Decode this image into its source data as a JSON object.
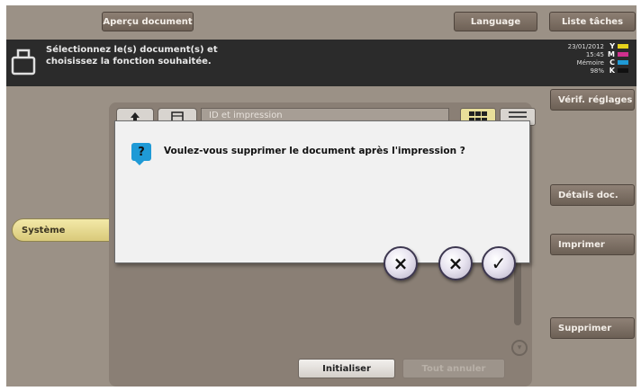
{
  "topbar": {
    "preview_label": "Aperçu document",
    "language_label": "Language",
    "jobs_label": "Liste tâches"
  },
  "message": {
    "text": "Sélectionnez le(s) document(s) et\nchoisissez la fonction souhaitée."
  },
  "status": {
    "date": "23/01/2012",
    "time": "15:45",
    "memory_label": "Mémoire",
    "memory_value": "98%"
  },
  "toner": [
    {
      "label": "Y",
      "color": "#e6d21c"
    },
    {
      "label": "M",
      "color": "#d0308e"
    },
    {
      "label": "C",
      "color": "#1f9ad6"
    },
    {
      "label": "K",
      "color": "#111111"
    }
  ],
  "sidebar": {
    "system_label": "Système"
  },
  "panel": {
    "path_label": "ID et impression"
  },
  "right_buttons": {
    "verify_label": "Vérif. réglages",
    "details_label": "Détails doc.",
    "print_label": "Imprimer",
    "delete_label": "Supprimer"
  },
  "bottom": {
    "reset_label": "Initialiser",
    "disabled_label": "Tout annuler"
  },
  "dialog": {
    "question_icon": "?",
    "text": "Voulez-vous supprimer le document après l'impression ?",
    "buttons": [
      "×",
      "×",
      "✓"
    ]
  }
}
